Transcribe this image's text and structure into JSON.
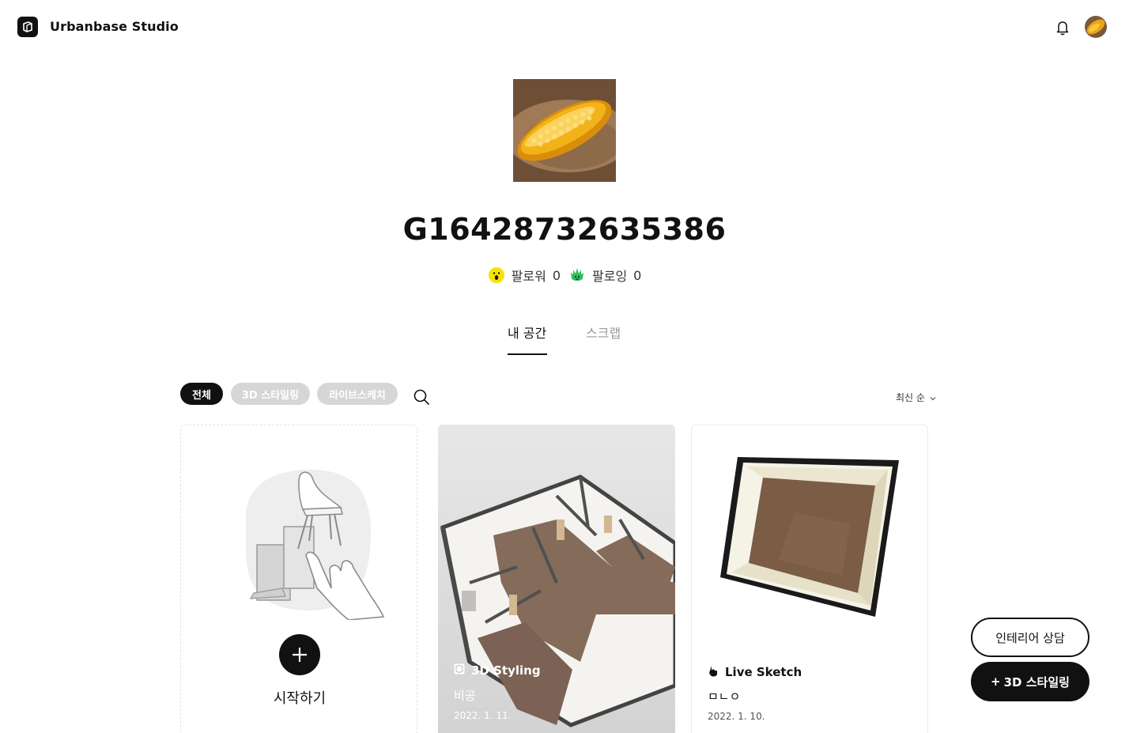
{
  "header": {
    "brand": "Urbanbase Studio",
    "icons": [
      "urbanbase-logo-icon",
      "bell-icon",
      "user-avatar"
    ]
  },
  "profile": {
    "username": "G16428732635386",
    "followers_label": "팔로워",
    "followers_count": "0",
    "following_label": "팔로잉",
    "following_count": "0"
  },
  "tabs": [
    {
      "label": "내 공간",
      "active": true
    },
    {
      "label": "스크랩",
      "active": false
    }
  ],
  "filters": {
    "chips": [
      {
        "label": "전체",
        "active": true
      },
      {
        "label": "3D 스타일링",
        "active": false
      },
      {
        "label": "라이브스케치",
        "active": false
      }
    ],
    "sort_label": "최신 순"
  },
  "cards": {
    "start": {
      "label": "시작하기"
    },
    "styling": {
      "type": "3D Styling",
      "title": "비공",
      "date": "2022. 1. 11."
    },
    "sketch": {
      "type": "Live Sketch",
      "title": "ㅁㄴㅇ",
      "date": "2022. 1. 10."
    }
  },
  "floating": {
    "consult_label": "인테리어 상담",
    "styling_label": "3D 스타일링",
    "styling_prefix": "+"
  },
  "colors": {
    "primary": "#111111",
    "chip_inactive": "#d6d6d6",
    "muted_text": "#9a9a9a",
    "follower_emoji": "#f7e200",
    "following_emoji": "#2fc05a"
  }
}
